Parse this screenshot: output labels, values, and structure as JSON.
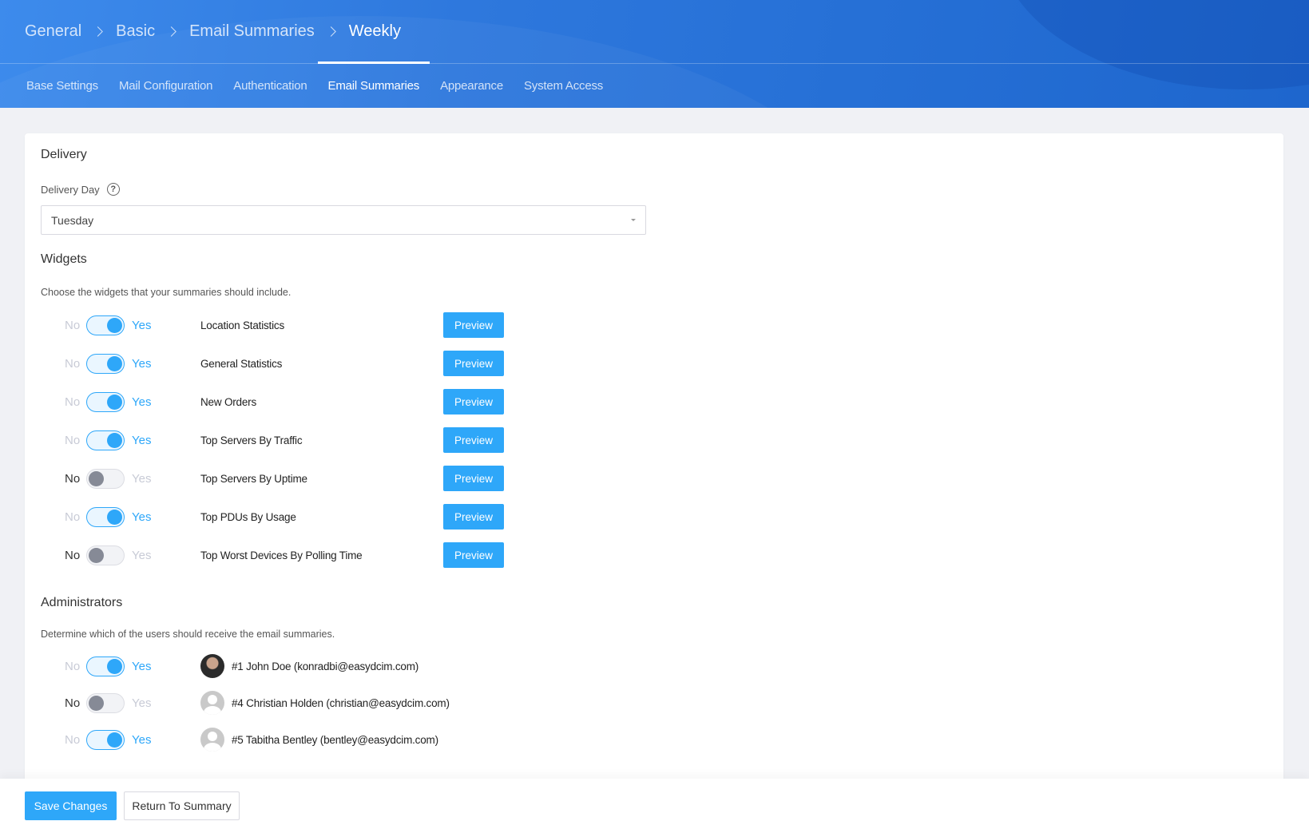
{
  "breadcrumb": [
    {
      "label": "General"
    },
    {
      "label": "Basic"
    },
    {
      "label": "Email Summaries"
    },
    {
      "label": "Weekly"
    }
  ],
  "tabs": [
    {
      "label": "Base Settings",
      "active": false
    },
    {
      "label": "Mail Configuration",
      "active": false
    },
    {
      "label": "Authentication",
      "active": false
    },
    {
      "label": "Email Summaries",
      "active": true
    },
    {
      "label": "Appearance",
      "active": false
    },
    {
      "label": "System Access",
      "active": false
    }
  ],
  "delivery": {
    "title": "Delivery",
    "day_label": "Delivery Day",
    "help_icon": "question-circle-icon",
    "day_value": "Tuesday"
  },
  "widgets": {
    "title": "Widgets",
    "description": "Choose the widgets that your summaries should include.",
    "no_label": "No",
    "yes_label": "Yes",
    "preview_label": "Preview",
    "items": [
      {
        "name": "Location Statistics",
        "enabled": true
      },
      {
        "name": "General Statistics",
        "enabled": true
      },
      {
        "name": "New Orders",
        "enabled": true
      },
      {
        "name": "Top Servers By Traffic",
        "enabled": true
      },
      {
        "name": "Top Servers By Uptime",
        "enabled": false
      },
      {
        "name": "Top PDUs By Usage",
        "enabled": true
      },
      {
        "name": "Top Worst Devices By Polling Time",
        "enabled": false
      }
    ]
  },
  "administrators": {
    "title": "Administrators",
    "description": "Determine which of the users should receive the email summaries.",
    "no_label": "No",
    "yes_label": "Yes",
    "users": [
      {
        "label": "#1 John Doe (konradbi@easydcim.com)",
        "enabled": true,
        "avatar": "photo"
      },
      {
        "label": "#4 Christian Holden (christian@easydcim.com)",
        "enabled": false,
        "avatar": "default"
      },
      {
        "label": "#5 Tabitha Bentley (bentley@easydcim.com)",
        "enabled": true,
        "avatar": "default"
      }
    ]
  },
  "footer": {
    "save_label": "Save Changes",
    "return_label": "Return To Summary"
  },
  "colors": {
    "accent": "#2ea7f9",
    "header": "#2e78dd",
    "background": "#f0f1f5"
  }
}
